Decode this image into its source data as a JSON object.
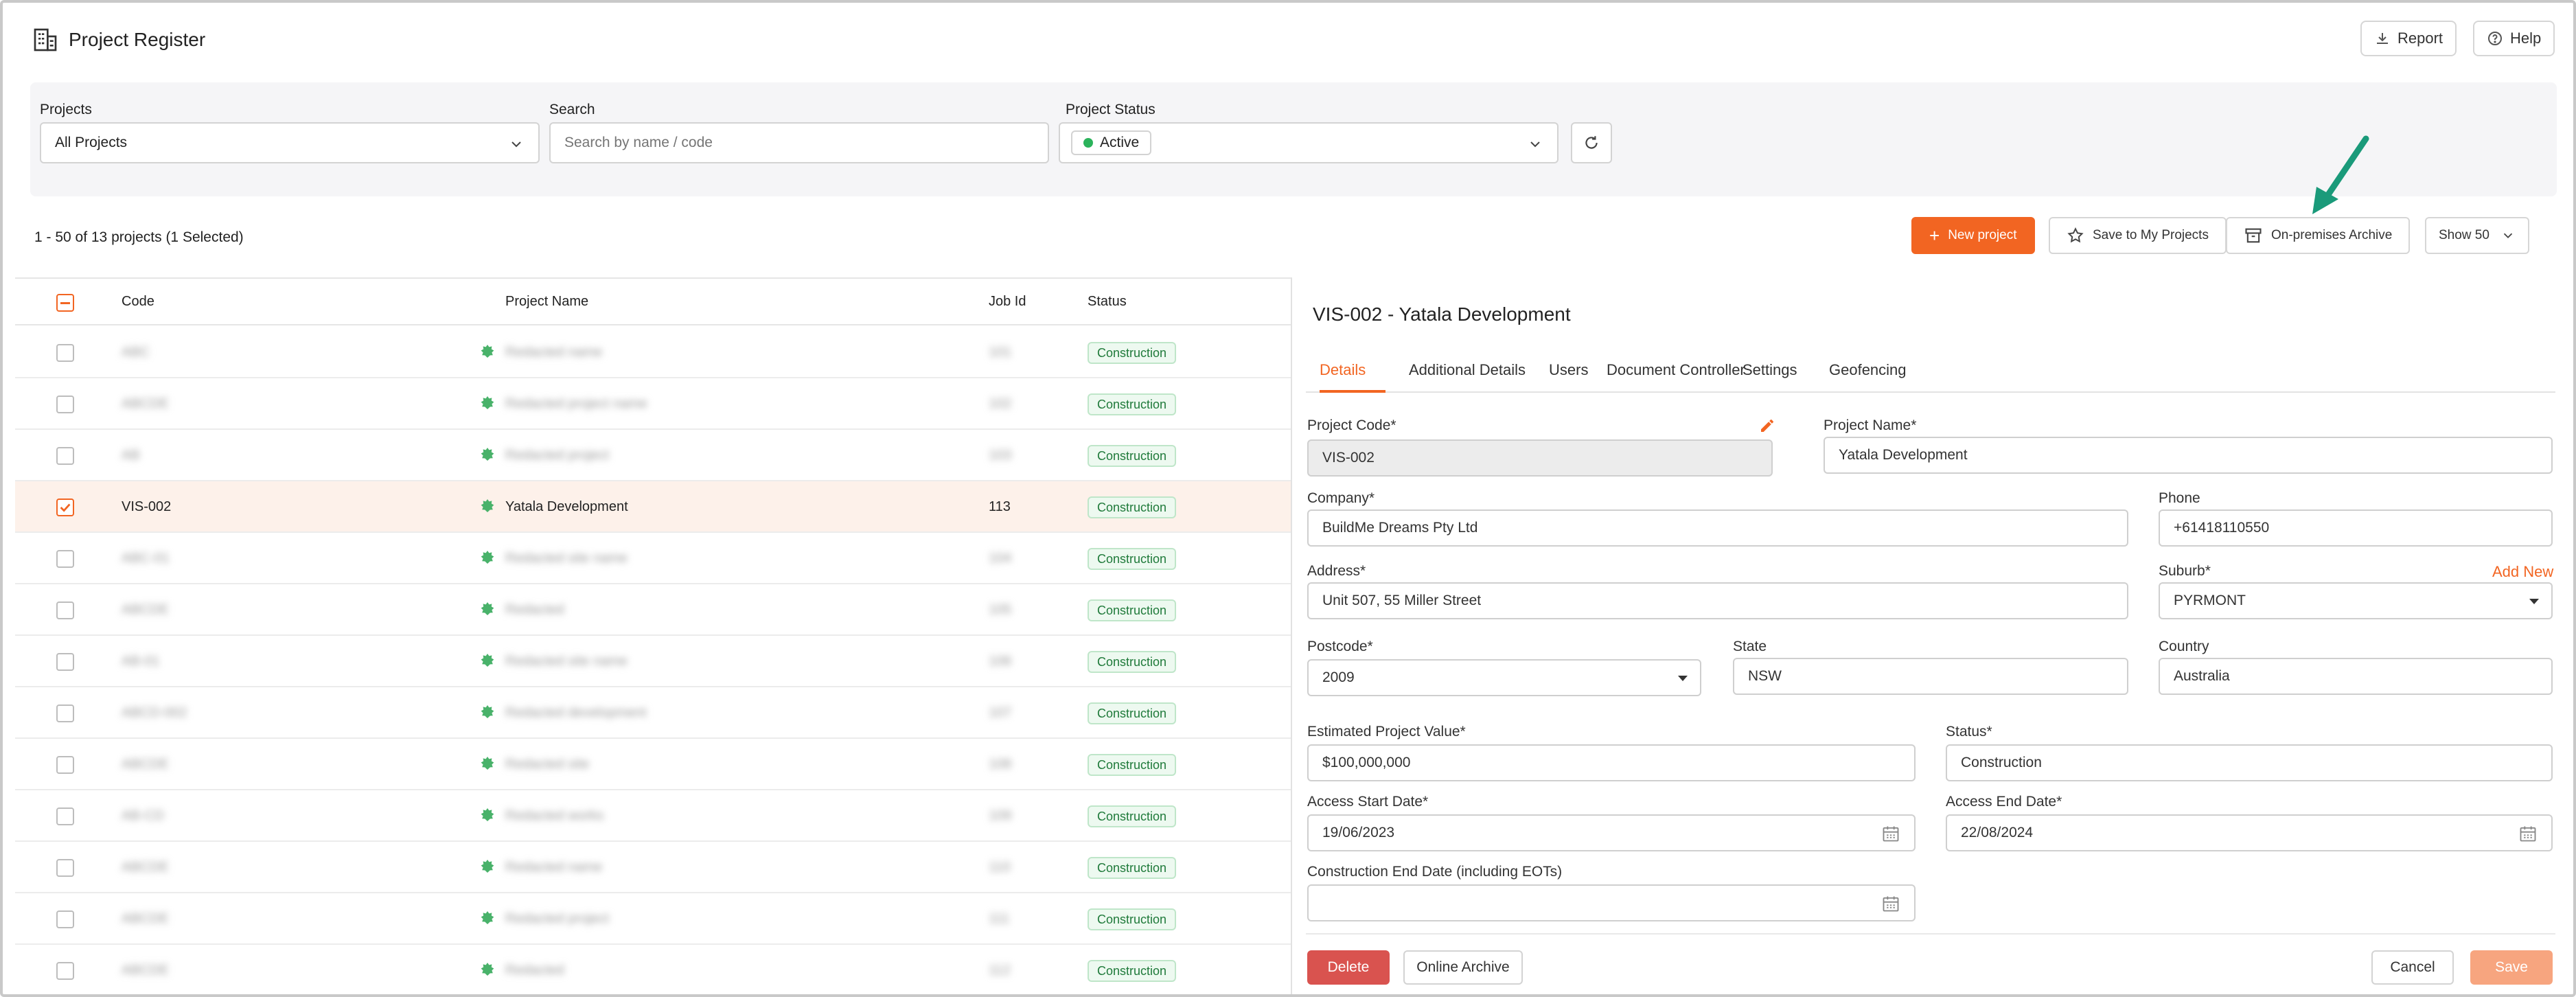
{
  "app": {
    "title": "Project Register"
  },
  "top_actions": {
    "report": "Report",
    "help": "Help"
  },
  "filters": {
    "projects_label": "Projects",
    "projects_value": "All Projects",
    "search_label": "Search",
    "search_placeholder": "Search by name / code",
    "status_label": "Project Status",
    "status_value": "Active"
  },
  "toolbar": {
    "count_text": "1 - 50 of 13 projects (1 Selected)",
    "new_project": "New project",
    "save_to_my_projects": "Save to My Projects",
    "on_premises_archive": "On-premises Archive",
    "show": "Show 50"
  },
  "table": {
    "headers": {
      "code": "Code",
      "name": "Project Name",
      "job_id": "Job Id",
      "status": "Status"
    },
    "rows": [
      {
        "code": "ABC",
        "name": "Redacted name",
        "job": "101",
        "status": "Construction",
        "selected": false
      },
      {
        "code": "ABCDE",
        "name": "Redacted project name",
        "job": "102",
        "status": "Construction",
        "selected": false
      },
      {
        "code": "AB",
        "name": "Redacted project",
        "job": "103",
        "status": "Construction",
        "selected": false
      },
      {
        "code": "VIS-002",
        "name": "Yatala Development",
        "job": "113",
        "status": "Construction",
        "selected": true
      },
      {
        "code": "ABC-01",
        "name": "Redacted site name",
        "job": "104",
        "status": "Construction",
        "selected": false
      },
      {
        "code": "ABCDE",
        "name": "Redacted",
        "job": "105",
        "status": "Construction",
        "selected": false
      },
      {
        "code": "AB-01",
        "name": "Redacted site name",
        "job": "106",
        "status": "Construction",
        "selected": false
      },
      {
        "code": "ABCD-002",
        "name": "Redacted development",
        "job": "107",
        "status": "Construction",
        "selected": false
      },
      {
        "code": "ABCDE",
        "name": "Redacted site",
        "job": "108",
        "status": "Construction",
        "selected": false
      },
      {
        "code": "AB-CD",
        "name": "Redacted works",
        "job": "109",
        "status": "Construction",
        "selected": false
      },
      {
        "code": "ABCDE",
        "name": "Redacted name",
        "job": "110",
        "status": "Construction",
        "selected": false
      },
      {
        "code": "ABCDE",
        "name": "Redacted project",
        "job": "111",
        "status": "Construction",
        "selected": false
      },
      {
        "code": "ABCDE",
        "name": "Redacted",
        "job": "112",
        "status": "Construction",
        "selected": false
      }
    ]
  },
  "detail": {
    "title": "VIS-002 - Yatala Development",
    "tabs": [
      "Details",
      "Additional Details",
      "Users",
      "Document Controller",
      "Settings",
      "Geofencing"
    ],
    "project_code_label": "Project Code*",
    "project_code": "VIS-002",
    "project_name_label": "Project Name*",
    "project_name": "Yatala Development",
    "company_label": "Company*",
    "company": "BuildMe Dreams Pty Ltd",
    "phone_label": "Phone",
    "phone": "+61418110550",
    "address_label": "Address*",
    "address": "Unit 507, 55 Miller Street",
    "suburb_label": "Suburb*",
    "add_new": "Add New",
    "suburb": "PYRMONT",
    "postcode_label": "Postcode*",
    "postcode": "2009",
    "state_label": "State",
    "state": "NSW",
    "country_label": "Country",
    "country": "Australia",
    "value_label": "Estimated Project Value*",
    "value": "$100,000,000",
    "status_label": "Status*",
    "status": "Construction",
    "access_start_label": "Access Start Date*",
    "access_start": "19/06/2023",
    "access_end_label": "Access End Date*",
    "access_end": "22/08/2024",
    "construction_end_label": "Construction End Date (including EOTs)",
    "construction_end": "",
    "delete": "Delete",
    "online_archive": "Online Archive",
    "cancel": "Cancel",
    "save": "Save"
  },
  "colors": {
    "accent": "#f26522",
    "delete": "#d9534f",
    "arrow": "#1a9a7a",
    "badge_bg": "#edf9f0"
  }
}
